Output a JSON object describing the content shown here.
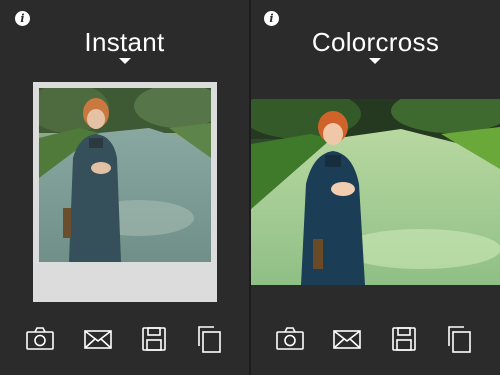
{
  "panels": [
    {
      "id": "instant",
      "title": "Instant",
      "info_glyph": "i",
      "toolbar": [
        "camera-icon",
        "mail-icon",
        "save-icon",
        "copy-icon"
      ]
    },
    {
      "id": "colorcross",
      "title": "Colorcross",
      "info_glyph": "i",
      "toolbar": [
        "camera-icon",
        "mail-icon",
        "save-icon",
        "copy-icon"
      ]
    }
  ],
  "colors": {
    "background": "#2b2b2b",
    "polaroid_frame": "#dcdcdc",
    "foreground": "#ffffff"
  }
}
